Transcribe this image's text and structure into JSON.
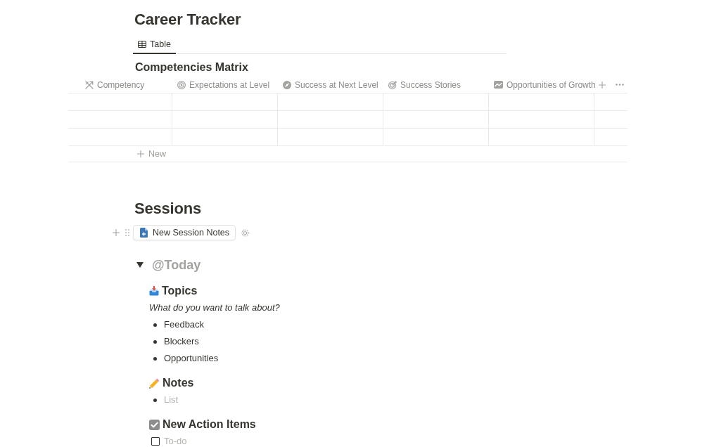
{
  "page": {
    "title": "Career Tracker"
  },
  "views": [
    {
      "label": "Table",
      "selected": true
    }
  ],
  "database": {
    "title": "Competencies Matrix",
    "columns": [
      "Competency",
      "Expectations at Level",
      "Success at Next Level",
      "Success Stories",
      "Opportunities of Growth"
    ],
    "rows": [
      {},
      {},
      {}
    ],
    "new_row": {
      "label": "New"
    }
  },
  "sessions": {
    "title": "Sessions",
    "button": {
      "label": "New Session Notes"
    },
    "toggle": {
      "title": "@Today",
      "expanded": true,
      "sections": [
        {
          "heading": "Topics",
          "blocks": [
            {
              "kind": "prompt",
              "text": "What do you want to talk about?"
            },
            {
              "kind": "bullet",
              "text": "Feedback"
            },
            {
              "kind": "bullet",
              "text": "Blockers"
            },
            {
              "kind": "bullet",
              "text": "Opportunities"
            }
          ]
        },
        {
          "heading": "Notes",
          "blocks": [
            {
              "kind": "bullet",
              "placeholder": "List"
            }
          ]
        },
        {
          "heading": "New Action Items",
          "blocks": [
            {
              "kind": "todo",
              "placeholder": "To-do",
              "checked": false
            }
          ]
        }
      ]
    }
  }
}
